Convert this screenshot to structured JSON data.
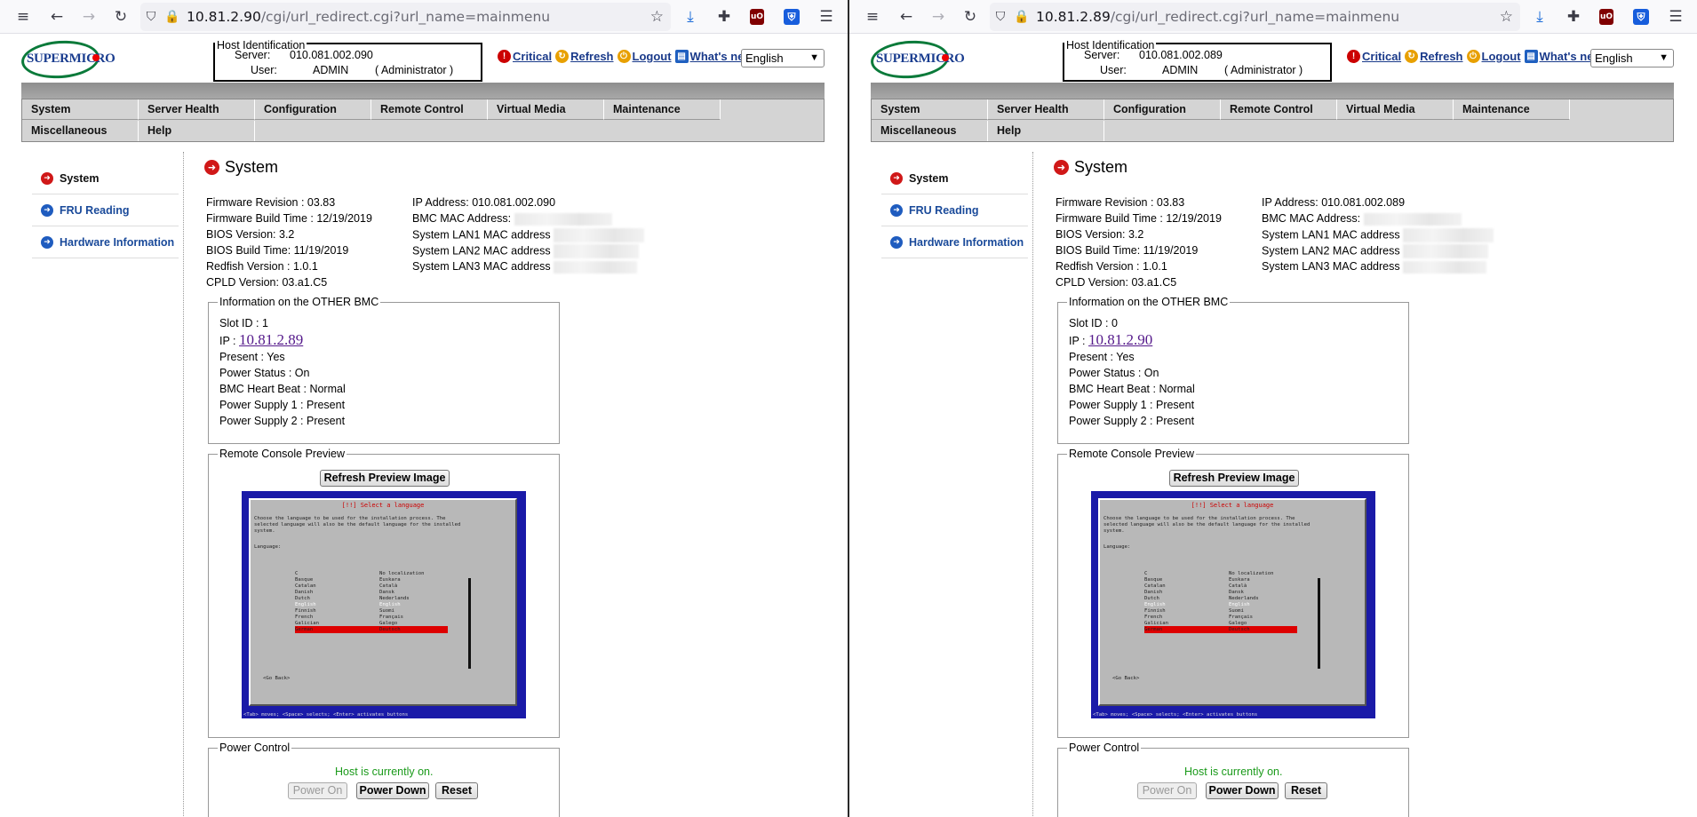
{
  "left": {
    "url_host": "10.81.2.90",
    "url_path": "/cgi/url_redirect.cgi?url_name=mainmenu",
    "logo": "SUPERMICRO",
    "host_identification": {
      "legend": "Host Identification",
      "server_label": "Server:",
      "server": "010.081.002.090",
      "user_label": "User:",
      "user": "ADMIN",
      "role": "( Administrator )"
    },
    "header_links": {
      "critical": "Critical",
      "refresh": "Refresh",
      "logout": "Logout",
      "whats_new": "What's new"
    },
    "language": "English",
    "menu": [
      "System",
      "Server Health",
      "Configuration",
      "Remote Control",
      "Virtual Media",
      "Maintenance",
      "Miscellaneous",
      "Help"
    ],
    "sidebar": [
      "System",
      "FRU Reading",
      "Hardware Information"
    ],
    "title": "System",
    "firmware": [
      {
        "label": "Firmware Revision :",
        "value": "03.83"
      },
      {
        "label": "Firmware Build Time :",
        "value": "12/19/2019"
      },
      {
        "label": "BIOS Version:",
        "value": "3.2"
      },
      {
        "label": "BIOS Build Time:",
        "value": "11/19/2019"
      },
      {
        "label": "Redfish Version :",
        "value": "1.0.1"
      },
      {
        "label": "CPLD Version:",
        "value": "03.a1.C5"
      }
    ],
    "network": [
      {
        "label": "IP Address:",
        "value": "010.081.002.090"
      },
      {
        "label": "BMC MAC Address:",
        "value": ""
      },
      {
        "label": "System LAN1 MAC address",
        "value": ""
      },
      {
        "label": "System LAN2 MAC address",
        "value": ""
      },
      {
        "label": "System LAN3 MAC address",
        "value": ""
      }
    ],
    "other_bmc": {
      "legend": "Information on the OTHER BMC",
      "slot_label": "Slot ID :",
      "slot": "1",
      "ip_label": "IP :",
      "ip": "10.81.2.89",
      "present_label": "Present :",
      "present": "Yes",
      "power_status_label": "Power Status :",
      "power_status": "On",
      "heartbeat_label": "BMC Heart Beat :",
      "heartbeat": "Normal",
      "ps1_label": "Power Supply 1 :",
      "ps1": "Present",
      "ps2_label": "Power Supply 2 :",
      "ps2": "Present"
    },
    "remote_console": {
      "legend": "Remote Console Preview",
      "refresh_button": "Refresh Preview Image"
    },
    "power_control": {
      "legend": "Power Control",
      "status": "Host is currently on.",
      "power_on": "Power On",
      "power_down": "Power Down",
      "reset": "Reset"
    }
  },
  "right": {
    "url_host": "10.81.2.89",
    "url_path": "/cgi/url_redirect.cgi?url_name=mainmenu",
    "logo": "SUPERMICRO",
    "host_identification": {
      "legend": "Host Identification",
      "server_label": "Server:",
      "server": "010.081.002.089",
      "user_label": "User:",
      "user": "ADMIN",
      "role": "( Administrator )"
    },
    "header_links": {
      "critical": "Critical",
      "refresh": "Refresh",
      "logout": "Logout",
      "whats_new": "What's new"
    },
    "language": "English",
    "menu": [
      "System",
      "Server Health",
      "Configuration",
      "Remote Control",
      "Virtual Media",
      "Maintenance",
      "Miscellaneous",
      "Help"
    ],
    "sidebar": [
      "System",
      "FRU Reading",
      "Hardware Information"
    ],
    "title": "System",
    "firmware": [
      {
        "label": "Firmware Revision :",
        "value": "03.83"
      },
      {
        "label": "Firmware Build Time :",
        "value": "12/19/2019"
      },
      {
        "label": "BIOS Version:",
        "value": "3.2"
      },
      {
        "label": "BIOS Build Time:",
        "value": "11/19/2019"
      },
      {
        "label": "Redfish Version :",
        "value": "1.0.1"
      },
      {
        "label": "CPLD Version:",
        "value": "03.a1.C5"
      }
    ],
    "network": [
      {
        "label": "IP Address:",
        "value": "010.081.002.089"
      },
      {
        "label": "BMC MAC Address:",
        "value": ""
      },
      {
        "label": "System LAN1 MAC address",
        "value": ""
      },
      {
        "label": "System LAN2 MAC address",
        "value": ""
      },
      {
        "label": "System LAN3 MAC address",
        "value": ""
      }
    ],
    "other_bmc": {
      "legend": "Information on the OTHER BMC",
      "slot_label": "Slot ID :",
      "slot": "0",
      "ip_label": "IP :",
      "ip": "10.81.2.90",
      "present_label": "Present :",
      "present": "Yes",
      "power_status_label": "Power Status :",
      "power_status": "On",
      "heartbeat_label": "BMC Heart Beat :",
      "heartbeat": "Normal",
      "ps1_label": "Power Supply 1 :",
      "ps1": "Present",
      "ps2_label": "Power Supply 2 :",
      "ps2": "Present"
    },
    "remote_console": {
      "legend": "Remote Console Preview",
      "refresh_button": "Refresh Preview Image"
    },
    "power_control": {
      "legend": "Power Control",
      "status": "Host is currently on.",
      "power_on": "Power On",
      "power_down": "Power Down",
      "reset": "Reset"
    }
  },
  "console_preview": {
    "title": "[!!] Select a language",
    "intro": "Choose the language to be used for the installation process. The\nselected language will also be the default language for the installed\nsystem.",
    "heading": "Language:",
    "languages": [
      "C",
      "Basque",
      "Catalan",
      "Danish",
      "Dutch",
      "English",
      "Finnish",
      "French",
      "Galician",
      "German"
    ],
    "native": [
      "No localization",
      "Euskara",
      "Català",
      "Dansk",
      "Nederlands",
      "English",
      "Suomi",
      "Français",
      "Galego",
      "Deutsch"
    ],
    "go_back": "<Go Back>",
    "footer": "<Tab> moves; <Space> selects; <Enter> activates buttons"
  },
  "icons": {
    "accent": "#1a3a8a",
    "status_green": "#1a9a1a",
    "menu_bg": "#d4d4d4"
  }
}
